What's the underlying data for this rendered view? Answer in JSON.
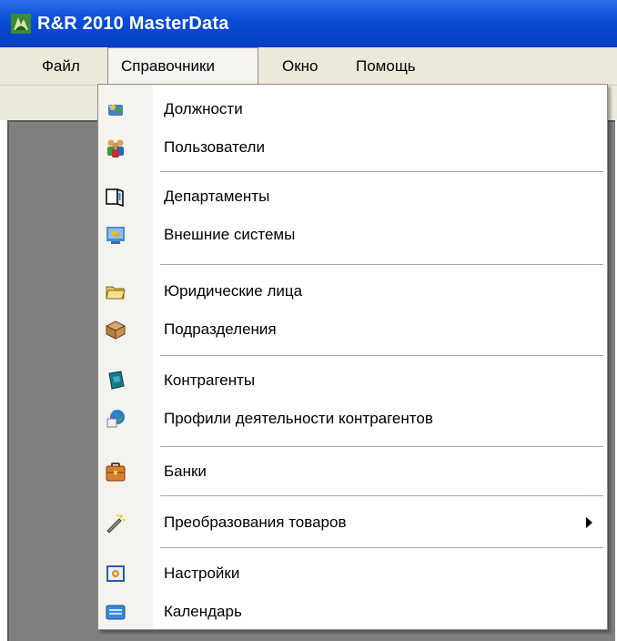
{
  "window": {
    "title": "R&R 2010 MasterData"
  },
  "menubar": {
    "items": [
      {
        "label": "Файл"
      },
      {
        "label": "Справочники",
        "active": true
      },
      {
        "label": "Окно"
      },
      {
        "label": "Помощь"
      }
    ]
  },
  "dropdown": {
    "items": [
      {
        "label": "Должности",
        "icon": "positions-icon"
      },
      {
        "label": "Пользователи",
        "icon": "users-icon"
      },
      {
        "label": "Департаменты",
        "icon": "departments-icon"
      },
      {
        "label": "Внешние системы",
        "icon": "external-systems-icon"
      },
      {
        "label": "Юридические лица",
        "icon": "legal-entities-icon"
      },
      {
        "label": "Подразделения",
        "icon": "subdivisions-icon"
      },
      {
        "label": "Контрагенты",
        "icon": "contractors-icon"
      },
      {
        "label": "Профили деятельности контрагентов",
        "icon": "contractor-profiles-icon"
      },
      {
        "label": "Банки",
        "icon": "banks-icon"
      },
      {
        "label": "Преобразования товаров",
        "icon": "goods-transform-icon",
        "submenu": true
      },
      {
        "label": "Настройки",
        "icon": "settings-icon"
      },
      {
        "label": "Календарь",
        "icon": "calendar-icon"
      }
    ]
  },
  "colors": {
    "titlebar": "#0a4bd6",
    "menubar": "#ece9d8",
    "workspace": "#808080"
  }
}
